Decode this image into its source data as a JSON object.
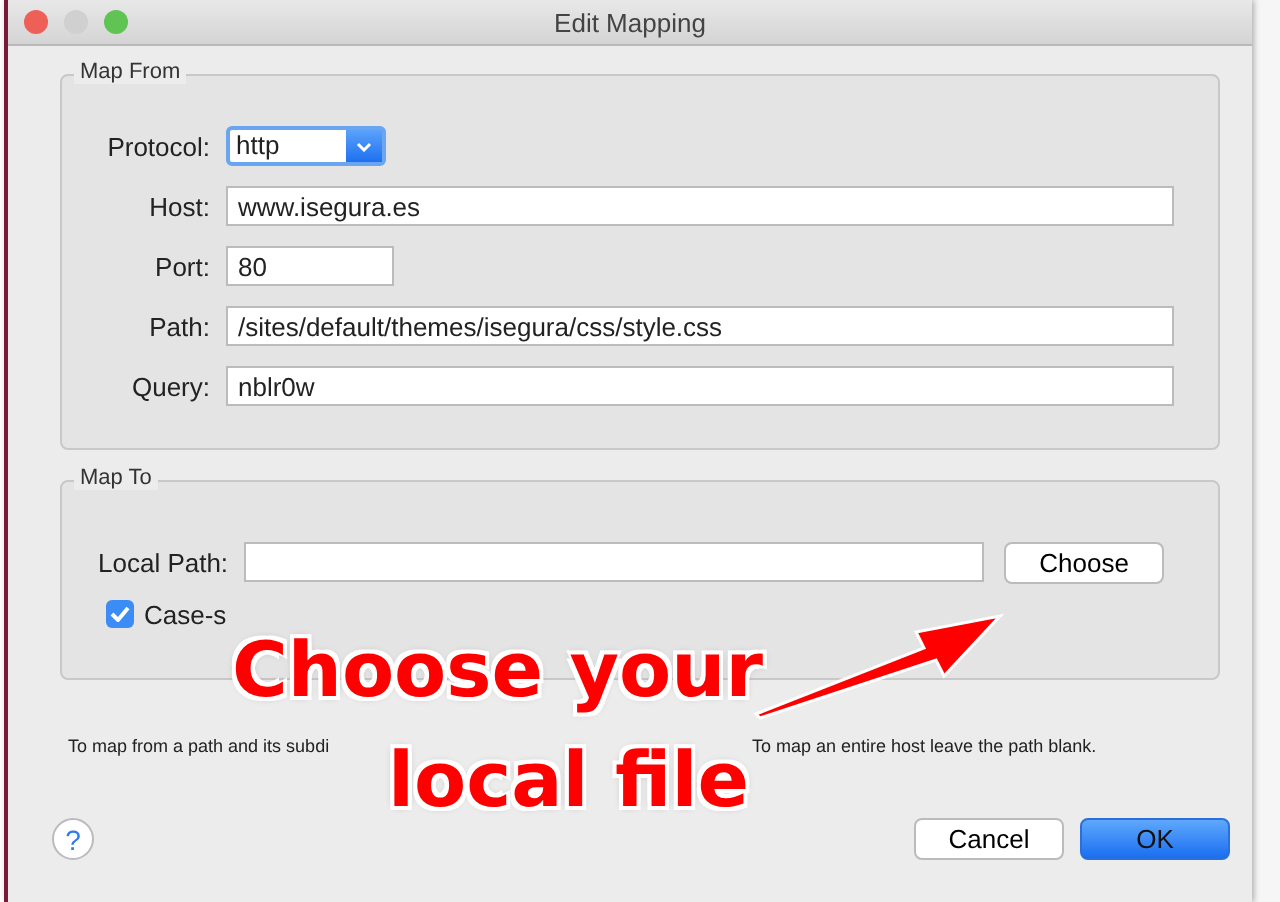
{
  "window": {
    "title": "Edit Mapping"
  },
  "map_from": {
    "title": "Map From",
    "fields": [
      {
        "kind": "select",
        "label": "Protocol:",
        "value": "http"
      },
      {
        "kind": "text",
        "label": "Host:",
        "value": "www.isegura.es"
      },
      {
        "kind": "short",
        "label": "Port:",
        "value": "80"
      },
      {
        "kind": "text",
        "label": "Path:",
        "value": "/sites/default/themes/isegura/css/style.css"
      },
      {
        "kind": "text",
        "label": "Query:",
        "value": "nblr0w"
      }
    ]
  },
  "map_to": {
    "title": "Map To",
    "local_path_label": "Local Path:",
    "choose_button": "Choose",
    "case_checkbox": {
      "label": "Case-s",
      "checked": true
    }
  },
  "help_text": [
    "To map from a path and its subdi",
    "To map an entire host leave the path blank."
  ],
  "help_button": "?",
  "buttons": [
    {
      "label": "Cancel",
      "kind": "secondary"
    },
    {
      "label": "OK",
      "kind": "primary"
    }
  ],
  "annotation": {
    "lines": [
      "Choose your",
      "local file"
    ]
  }
}
